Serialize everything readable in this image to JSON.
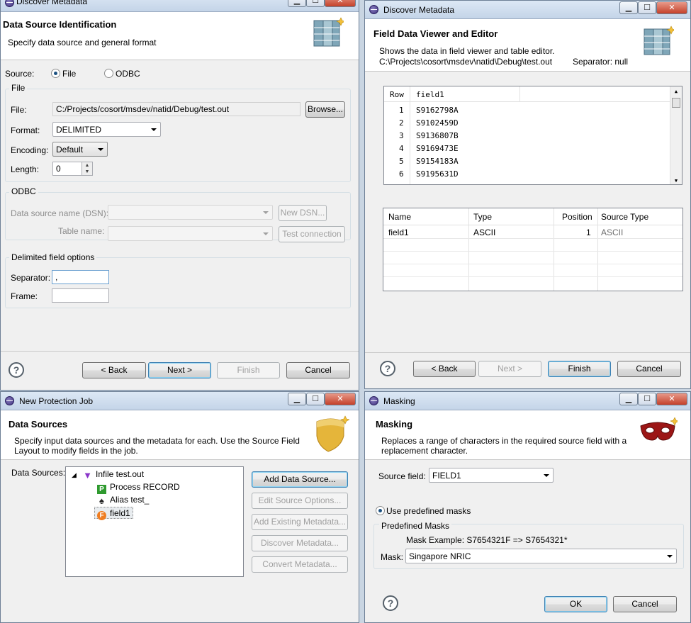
{
  "w1": {
    "title": "Discover Metadata",
    "header_title": "Data Source Identification",
    "header_desc": "Specify data source and general format",
    "source_label": "Source:",
    "source_file": "File",
    "source_odbc": "ODBC",
    "file_group": "File",
    "file_label": "File:",
    "file_value": "C:/Projects/cosort/msdev/natid/Debug/test.out",
    "browse": "Browse...",
    "format_label": "Format:",
    "format_value": "DELIMITED",
    "encoding_label": "Encoding:",
    "encoding_value": "Default",
    "length_label": "Length:",
    "length_value": "0",
    "odbc_group": "ODBC",
    "dsn_label": "Data source name (DSN):",
    "new_dsn": "New DSN...",
    "table_label": "Table name:",
    "test_conn": "Test connection",
    "delim_group": "Delimited field options",
    "separator_label": "Separator:",
    "separator_value": ",",
    "frame_label": "Frame:",
    "frame_value": "",
    "back": "< Back",
    "next": "Next >",
    "finish": "Finish",
    "cancel": "Cancel"
  },
  "w2": {
    "title": "Discover Metadata",
    "header_title": "Field Data Viewer and Editor",
    "header_desc1": "Shows the data in field viewer and table editor.",
    "header_path": "C:\\Projects\\cosort\\msdev\\natid\\Debug\\test.out",
    "header_sep": "Separator: null",
    "data_cols": [
      "Row",
      "field1"
    ],
    "data_rows": [
      {
        "row": "1",
        "field1": "S9162798A"
      },
      {
        "row": "2",
        "field1": "S9102459D"
      },
      {
        "row": "3",
        "field1": "S9136807B"
      },
      {
        "row": "4",
        "field1": "S9169473E"
      },
      {
        "row": "5",
        "field1": "S9154183A"
      },
      {
        "row": "6",
        "field1": "S9195631D"
      }
    ],
    "meta_cols": [
      "Name",
      "Type",
      "Position",
      "Source Type"
    ],
    "meta_row": {
      "name": "field1",
      "type": "ASCII",
      "position": "1",
      "source_type": "ASCII"
    },
    "back": "< Back",
    "next": "Next >",
    "finish": "Finish",
    "cancel": "Cancel"
  },
  "w3": {
    "title": "New Protection Job",
    "header_title": "Data Sources",
    "header_desc1": "Specify input data sources and the metadata for each. Use the Source Field",
    "header_desc2": "Layout to modify fields in the job.",
    "ds_label": "Data Sources:",
    "tree": {
      "root": "Infile test.out",
      "process": "Process RECORD",
      "alias": "Alias test_",
      "field": "field1"
    },
    "btn_add": "Add Data Source...",
    "btn_edit": "Edit Source Options...",
    "btn_existing": "Add Existing Metadata...",
    "btn_discover": "Discover Metadata...",
    "btn_convert": "Convert Metadata..."
  },
  "w4": {
    "title": "Masking",
    "header_title": "Masking",
    "header_desc1": "Replaces a range of characters in the required source field with a",
    "header_desc2": "replacement character.",
    "source_field_label": "Source field:",
    "source_field_value": "FIELD1",
    "predef_radio": "Use predefined masks",
    "predef_group": "Predefined Masks",
    "mask_example": "Mask Example: S7654321F => S7654321*",
    "mask_label": "Mask:",
    "mask_value": "Singapore NRIC",
    "ok": "OK",
    "cancel": "Cancel"
  },
  "window_buttons": {
    "minimize": "▁",
    "maximize": "☐",
    "close": "✕"
  },
  "help_glyph": "?"
}
